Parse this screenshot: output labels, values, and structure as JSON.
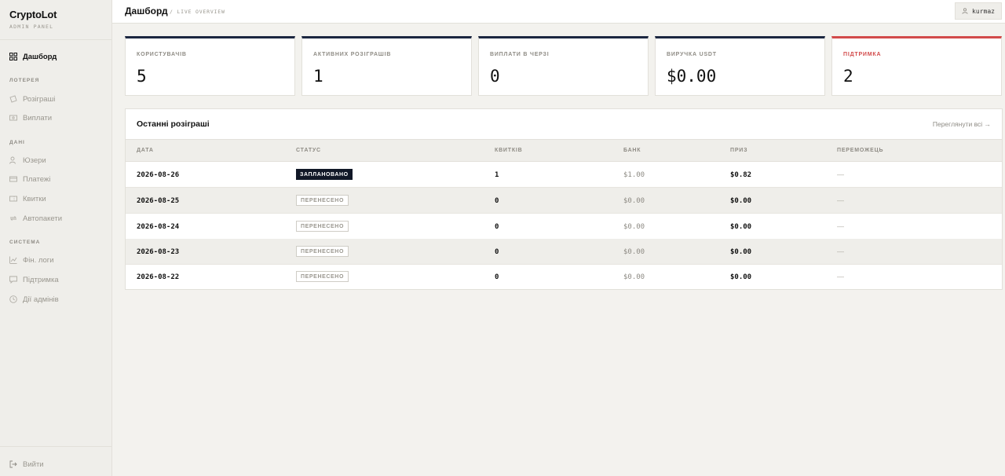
{
  "brand": {
    "title": "CryptoLot",
    "subtitle": "ADMIN PANEL"
  },
  "sidebar": {
    "dashboard": "Дашборд",
    "sections": {
      "lottery": "ЛОТЕРЕЯ",
      "data": "ДАНІ",
      "system": "СИСТЕМА"
    },
    "items": {
      "draws": "Розіграші",
      "payouts": "Виплати",
      "users": "Юзери",
      "payments": "Платежі",
      "tickets": "Квитки",
      "autopackets": "Автопакети",
      "fin_logs": "Фін. логи",
      "support": "Підтримка",
      "admin_actions": "Дії адмінів"
    },
    "logout": "Вийти"
  },
  "topbar": {
    "title": "Дашборд",
    "crumb": "/ LIVE OVERVIEW",
    "user": "kurmaz"
  },
  "stats": [
    {
      "label": "КОРИСТУВАЧІВ",
      "value": "5"
    },
    {
      "label": "АКТИВНИХ РОЗІГРАШІВ",
      "value": "1"
    },
    {
      "label": "ВИПЛАТИ В ЧЕРЗІ",
      "value": "0"
    },
    {
      "label": "ВИРУЧКА USDT",
      "value": "$0.00"
    },
    {
      "label": "ПІДТРИМКА",
      "value": "2"
    }
  ],
  "recent": {
    "title": "Останні розіграші",
    "view_all": "Переглянути всі →",
    "columns": [
      "ДАТА",
      "СТАТУС",
      "КВИТКІВ",
      "БАНК",
      "ПРИЗ",
      "ПЕРЕМОЖЕЦЬ"
    ],
    "rows": [
      {
        "date": "2026-08-26",
        "status": "ЗАПЛАНОВАНО",
        "tickets": "1",
        "bank": "$1.00",
        "prize": "$0.82",
        "winner": "—"
      },
      {
        "date": "2026-08-25",
        "status": "ПЕРЕНЕСЕНО",
        "tickets": "0",
        "bank": "$0.00",
        "prize": "$0.00",
        "winner": "—"
      },
      {
        "date": "2026-08-24",
        "status": "ПЕРЕНЕСЕНО",
        "tickets": "0",
        "bank": "$0.00",
        "prize": "$0.00",
        "winner": "—"
      },
      {
        "date": "2026-08-23",
        "status": "ПЕРЕНЕСЕНО",
        "tickets": "0",
        "bank": "$0.00",
        "prize": "$0.00",
        "winner": "—"
      },
      {
        "date": "2026-08-22",
        "status": "ПЕРЕНЕСЕНО",
        "tickets": "0",
        "bank": "$0.00",
        "prize": "$0.00",
        "winner": "—"
      }
    ]
  },
  "colors": {
    "accent": "#1c2740",
    "alert": "#d24a4a",
    "badge_dark": "#111827"
  }
}
